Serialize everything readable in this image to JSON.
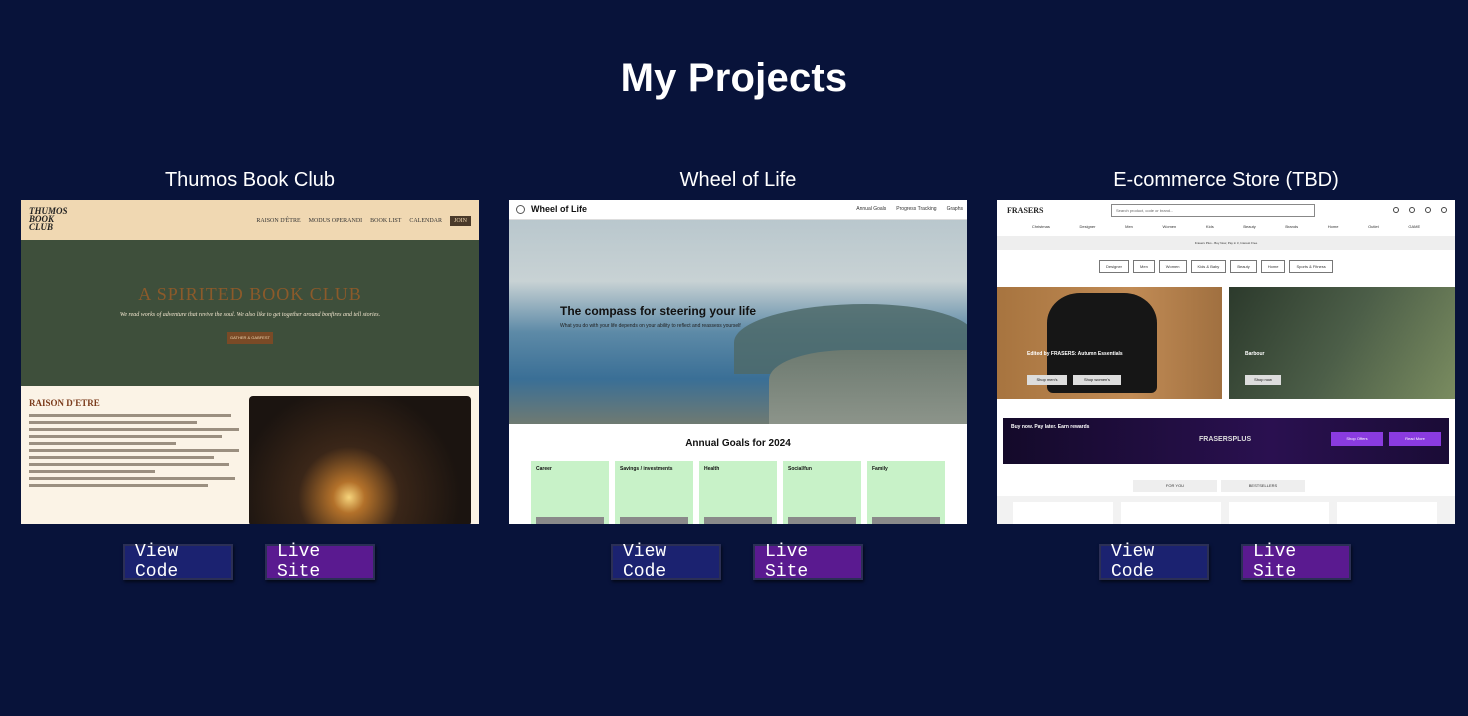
{
  "page": {
    "title": "My Projects"
  },
  "projects": [
    {
      "title": "Thumos Book Club",
      "view_code_label": "View Code",
      "live_site_label": "Live Site",
      "preview": {
        "logo": "THUMOS BOOK CLUB",
        "nav": [
          "RAISON D'ÊTRE",
          "MODUS OPERANDI",
          "BOOK LIST",
          "CALENDAR",
          "JOIN"
        ],
        "hero_title": "A SPIRITED BOOK CLUB",
        "hero_subtitle": "We read works of adventure that revive the soul. We also like to get together around bonfires and tell stories.",
        "hero_button": "GATHER & GABFEST",
        "section_title": "RAISON D'ETRE"
      }
    },
    {
      "title": "Wheel of Life",
      "view_code_label": "View Code",
      "live_site_label": "Live Site",
      "preview": {
        "brand": "Wheel of Life",
        "nav": [
          "Annual Goals",
          "Progress Tracking",
          "Graphs"
        ],
        "hero_title": "The compass for steering your life",
        "hero_subtitle": "What you do with your life depends on your ability to reflect and reassess yourself",
        "goals_title": "Annual Goals for 2024",
        "goals": [
          "Career",
          "Savings / investments",
          "Health",
          "Social/fun",
          "Family"
        ]
      }
    },
    {
      "title": "E-commerce Store (TBD)",
      "view_code_label": "View Code",
      "live_site_label": "Live Site",
      "preview": {
        "logo": "FRASERS",
        "search_placeholder": "Search product, code or brand...",
        "categories": [
          "Christmas",
          "Designer",
          "Men",
          "Women",
          "Kids",
          "Beauty",
          "Brands",
          "Home",
          "Outlet",
          "GAME"
        ],
        "banner": "Frasers Plus - Buy Now, Pay in 3, Interest Free",
        "pills": [
          "Designer",
          "Men",
          "Women",
          "Kids & Baby",
          "Beauty",
          "Home",
          "Sports & Fitness"
        ],
        "promo1_title": "Edited by FRASERS: Autumn Essentials",
        "promo1_btn1": "Shop men's",
        "promo1_btn2": "Shop women's",
        "promo2_title": "Barbour",
        "promo2_btn": "Shop now",
        "plus_title": "Buy now. Pay later. Earn rewards",
        "plus_brand": "FRASERSPLUS",
        "plus_btn1": "Shop Offers",
        "plus_btn2": "Read More",
        "tabs": [
          "FOR YOU",
          "BESTSELLERS"
        ]
      }
    }
  ],
  "colors": {
    "background": "#08133a",
    "view_code_button": "#1b2270",
    "live_site_button": "#5a1a90"
  }
}
